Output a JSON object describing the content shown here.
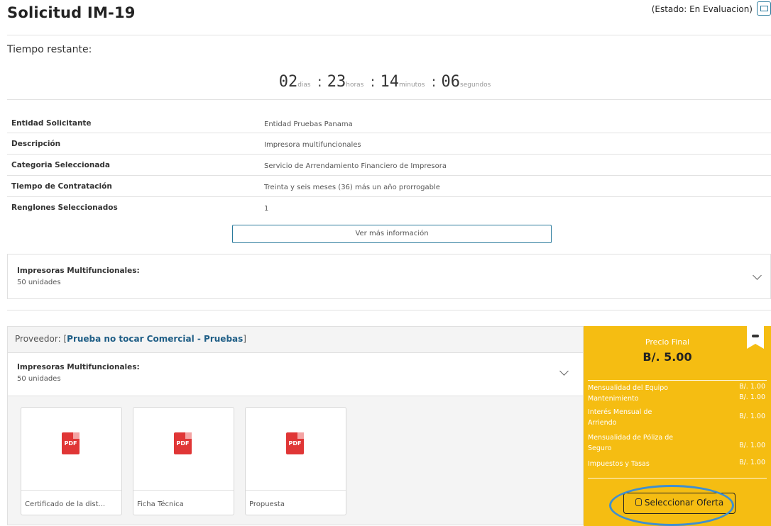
{
  "header": {
    "title": "Solicitud IM-19",
    "status": "(Estado: En Evaluacion)"
  },
  "countdown": {
    "label": "Tiempo restante:",
    "days": "02",
    "days_unit": "dias",
    "hours": "23",
    "hours_unit": "horas",
    "minutes": "14",
    "minutes_unit": "minutos",
    "seconds": "06",
    "seconds_unit": "segundos",
    "separator": ":"
  },
  "info": [
    {
      "key": "Entidad Solicitante",
      "value": "Entidad Pruebas Panama"
    },
    {
      "key": "Descripción",
      "value": "Impresora multifuncionales"
    },
    {
      "key": "Categoria Seleccionada",
      "value": "Servicio de Arrendamiento Financiero de Impresora"
    },
    {
      "key": "Tiempo de Contratación",
      "value": "Treinta y seis meses (36) más un año prorrogable"
    },
    {
      "key": "Renglones Seleccionados",
      "value": "1"
    }
  ],
  "ver_mas_label": "Ver más información",
  "item": {
    "title": "Impresoras Multifuncionales:",
    "units": "50 unidades"
  },
  "proveedor": {
    "label": "Proveedor:",
    "bracket_open": "[",
    "name": "Prueba no tocar Comercial - Pruebas",
    "bracket_close": "]",
    "item_title": "Impresoras Multifuncionales:",
    "item_units": "50 unidades"
  },
  "documents": [
    {
      "icon": "pdf-icon",
      "icon_text": "PDF",
      "caption": "Certificado de la dist..."
    },
    {
      "icon": "pdf-icon",
      "icon_text": "PDF",
      "caption": "Ficha Técnica"
    },
    {
      "icon": "pdf-icon",
      "icon_text": "PDF",
      "caption": "Propuesta"
    }
  ],
  "price": {
    "label": "Precio Final",
    "value": "B/. 5.00",
    "breakdown": [
      {
        "label": "Mensualidad del Equipo",
        "value": "B/. 1.00"
      },
      {
        "label": "Mantenimiento",
        "value": "B/. 1.00"
      },
      {
        "label": "Interés Mensual de Arriendo",
        "value": "B/. 1.00"
      },
      {
        "label": "Mensualidad de Póliza de Seguro",
        "value": "B/. 1.00"
      },
      {
        "label": "Impuestos y Tasas",
        "value": "B/. 1.00"
      }
    ],
    "select_label": "Seleccionar Oferta"
  },
  "colors": {
    "accent": "#2a7a9c",
    "price_panel": "#f5bd12",
    "pdf": "#e03636",
    "highlight_oval": "#3f8fd0",
    "link": "#1f5e86"
  }
}
